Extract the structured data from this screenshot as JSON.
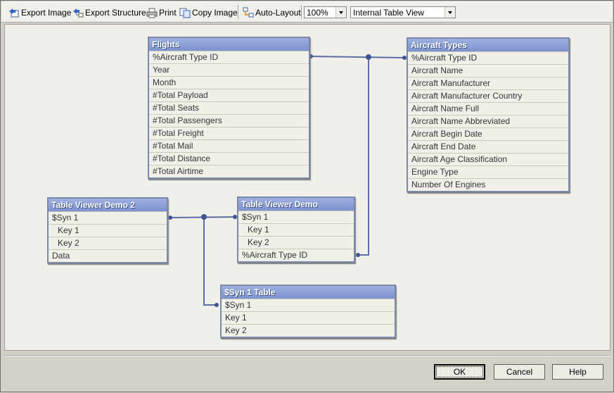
{
  "toolbar": {
    "export_image": "Export Image",
    "export_structure": "Export Structure",
    "print": "Print",
    "copy_image": "Copy Image",
    "auto_layout": "Auto-Layout",
    "zoom": "100%",
    "view": "Internal Table View"
  },
  "tables": {
    "flights": {
      "title": "Flights",
      "fields": [
        "%Aircraft Type ID",
        "Year",
        "Month",
        "#Total Payload",
        "#Total Seats",
        "#Total Passengers",
        "#Total Freight",
        "#Total Mail",
        "#Total Distance",
        "#Total Airtime"
      ]
    },
    "aircraft_types": {
      "title": "Aircraft Types",
      "fields": [
        "%Aircraft Type ID",
        "Aircraft Name",
        "Aircraft Manufacturer",
        "Aircraft Manufacturer Country",
        "Aircraft Name Full",
        "Aircraft Name Abbreviated",
        "Aircraft Begin Date",
        "Aircraft End Date",
        "Aircraft Age Classification",
        "Engine Type",
        "Number Of Engines"
      ]
    },
    "tvd2": {
      "title": "Table Viewer Demo 2",
      "fields": [
        "$Syn 1",
        "Key 1",
        "Key 2",
        "Data"
      ]
    },
    "tvd": {
      "title": "Table Viewer Demo",
      "fields": [
        "$Syn 1",
        "Key 1",
        "Key 2",
        "%Aircraft Type ID"
      ]
    },
    "syn": {
      "title": "$Syn 1 Table",
      "fields": [
        "$Syn 1",
        "Key 1",
        "Key 2"
      ]
    }
  },
  "buttons": {
    "ok": "OK",
    "cancel": "Cancel",
    "help": "Help"
  },
  "colors": {
    "table_header": "#7d93cf",
    "link_line": "#5b6fa6"
  }
}
